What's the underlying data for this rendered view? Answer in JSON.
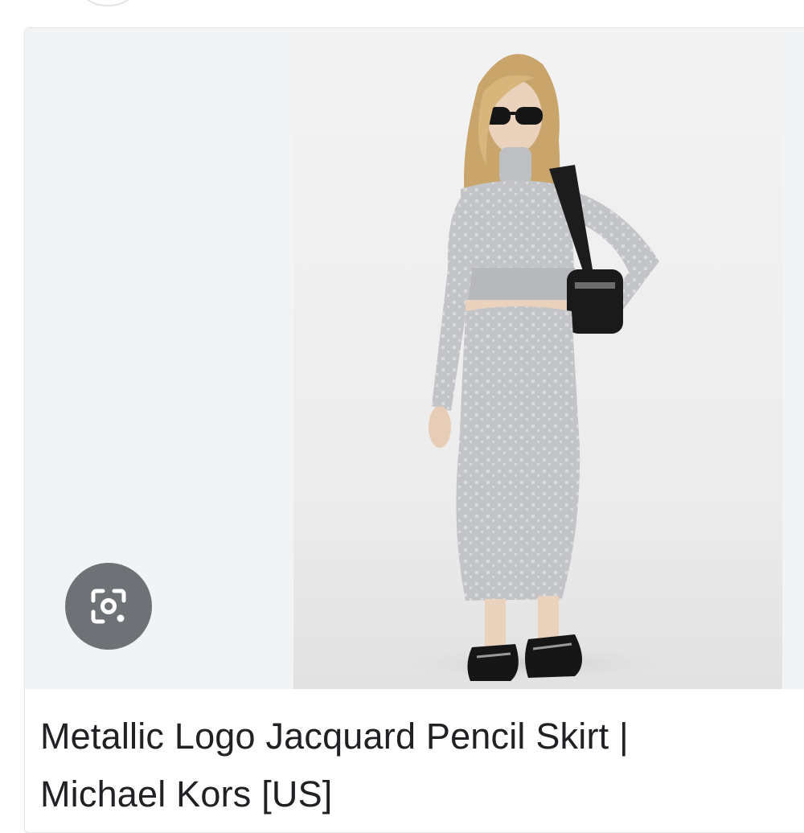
{
  "result": {
    "title_line1": "Metallic Logo Jacquard Pencil Skirt |",
    "title_line2": "Michael Kors [US]",
    "image_alt": "Model wearing grey metallic logo jacquard cropped sweater and pencil skirt",
    "lens_icon": "google-lens-icon"
  },
  "colors": {
    "title_text": "#202124",
    "lens_button_bg": "#5f6368",
    "image_background": "#f1f3f4"
  }
}
